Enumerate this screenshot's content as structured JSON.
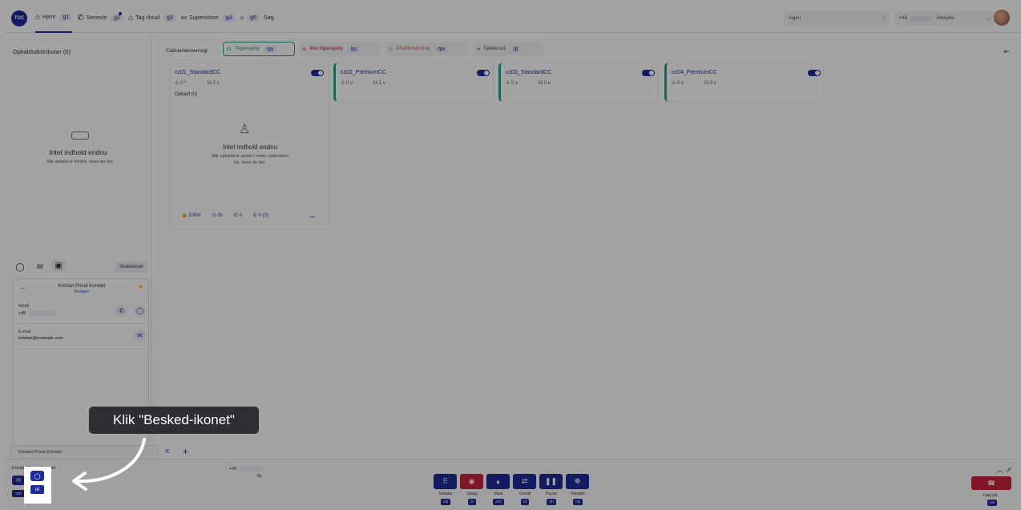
{
  "topbar": {
    "logo": "TOC",
    "nav": [
      {
        "label": "Hjem",
        "key": "g1",
        "icon": "home-icon"
      },
      {
        "label": "Seneste",
        "key": "g2",
        "icon": "phone-icon"
      },
      {
        "label": "Tag cloud",
        "key": "g3",
        "icon": "tag-icon"
      },
      {
        "label": "Supervision",
        "key": "g4",
        "icon": "supervision-icon"
      },
      {
        "label": "Søg",
        "key": "g5",
        "icon": "search-icon"
      }
    ],
    "status_select": "Ingen",
    "number_prefix": "+45",
    "work_status": "Arbejdei"
  },
  "left": {
    "title": "Opkaldsdistributør (0)",
    "empty_title": "Intet indhold endnu",
    "empty_sub": "Når opkald er fordelt, vises de her.",
    "templates_label": "Skabeloner",
    "contact": {
      "name": "Kristian Privat Kontakt",
      "edit": "Rediger",
      "mobile_label": "Mobil",
      "mobile_value": "+45",
      "email_label": "E-mail",
      "email_value": "kristian@example.com"
    }
  },
  "main": {
    "overview_title": "Callcenteroversigt",
    "filters": [
      {
        "label": "Tilgængelig",
        "key": "qa"
      },
      {
        "label": "Ikke tilgængelig",
        "key": "qu"
      },
      {
        "label": "Efterbehandling",
        "key": "qw"
      },
      {
        "label": "Tjekket ud",
        "key": "ql"
      }
    ],
    "queues": [
      {
        "name": "cc01_StandardCC",
        "agents": "0 ^",
        "supervisors": "2 v"
      },
      {
        "name": "cc02_PremiumCC",
        "agents": "0 v",
        "supervisors": "1 v"
      },
      {
        "name": "cc03_StandardCC",
        "agents": "0 v",
        "supervisors": "0 v"
      },
      {
        "name": "cc04_PremiumCC",
        "agents": "0 v",
        "supervisors": "0 v"
      }
    ],
    "calls_label": "Opkald (0)",
    "queue_empty_title": "Intet indhold endnu",
    "queue_empty_sub": "Når opkaldere venter i dette callcenters kø, vises de her.",
    "footer": {
      "rate": "100%",
      "time": "0s",
      "calls": "0",
      "missed": "0 (0)"
    }
  },
  "tabs": {
    "active": "Kristian Privat Kontakt"
  },
  "callbar": {
    "name": "Kristian Privat Kontakt",
    "number": "+45",
    "time": "8s",
    "small_buttons": [
      {
        "key": "cm"
      },
      {
        "key": "ot"
      }
    ],
    "controls": [
      {
        "label": "Tastatur",
        "key": "cd"
      },
      {
        "label": "Optag",
        "key": "cr"
      },
      {
        "label": "Mute",
        "key": "cm"
      },
      {
        "label": "Omstil",
        "key": "ct"
      },
      {
        "label": "Pause",
        "key": "ch"
      },
      {
        "label": "Flerpart",
        "key": "cp"
      }
    ],
    "hangup_label": "Læg på",
    "hangup_key": "ce"
  },
  "tooltip": "Klik \"Besked-ikonet\"",
  "colors": {
    "primary": "#1e2b9a",
    "available": "#20a58c",
    "danger": "#c7213a",
    "away": "#e06a4a"
  }
}
